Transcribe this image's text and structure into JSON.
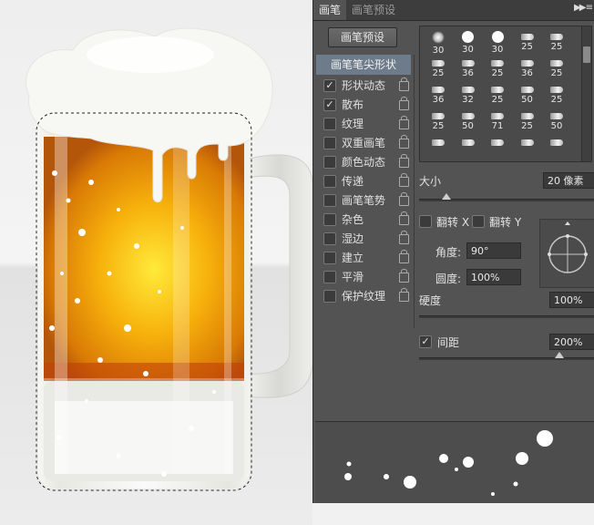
{
  "panel": {
    "tabs": [
      "画笔",
      "画笔预设"
    ],
    "preset_button": "画笔预设",
    "options": [
      {
        "label": "画笔笔尖形状",
        "checked": null
      },
      {
        "label": "形状动态",
        "checked": true
      },
      {
        "label": "散布",
        "checked": true
      },
      {
        "label": "纹理",
        "checked": false
      },
      {
        "label": "双重画笔",
        "checked": false
      },
      {
        "label": "颜色动态",
        "checked": false
      },
      {
        "label": "传递",
        "checked": false
      },
      {
        "label": "画笔笔势",
        "checked": false
      },
      {
        "label": "杂色",
        "checked": false
      },
      {
        "label": "湿边",
        "checked": false
      },
      {
        "label": "建立",
        "checked": false
      },
      {
        "label": "平滑",
        "checked": false
      },
      {
        "label": "保护纹理",
        "checked": false
      }
    ],
    "brush_tips": [
      {
        "size": "30",
        "icon": "soft-round"
      },
      {
        "size": "30",
        "icon": "hard-round"
      },
      {
        "size": "30",
        "icon": "hard-round"
      },
      {
        "size": "25",
        "icon": "stroke"
      },
      {
        "size": "25",
        "icon": "stroke"
      },
      {
        "size": "25",
        "icon": "stroke"
      },
      {
        "size": "36",
        "icon": "stroke"
      },
      {
        "size": "25",
        "icon": "stroke"
      },
      {
        "size": "36",
        "icon": "stroke"
      },
      {
        "size": "25",
        "icon": "stroke"
      },
      {
        "size": "36",
        "icon": "stroke"
      },
      {
        "size": "32",
        "icon": "stroke"
      },
      {
        "size": "25",
        "icon": "stroke"
      },
      {
        "size": "50",
        "icon": "stroke"
      },
      {
        "size": "25",
        "icon": "stroke"
      },
      {
        "size": "25",
        "icon": "stroke"
      },
      {
        "size": "50",
        "icon": "stroke"
      },
      {
        "size": "71",
        "icon": "stroke"
      },
      {
        "size": "25",
        "icon": "stroke"
      },
      {
        "size": "50",
        "icon": "stroke"
      },
      {
        "size": "",
        "icon": "stroke"
      },
      {
        "size": "",
        "icon": "stroke"
      },
      {
        "size": "",
        "icon": "stroke"
      },
      {
        "size": "",
        "icon": "stroke"
      },
      {
        "size": "",
        "icon": "stroke"
      }
    ],
    "size": {
      "label": "大小",
      "value": "20 像素",
      "level": 0.07
    },
    "flip_x": {
      "label": "翻转 X",
      "checked": false
    },
    "flip_y": {
      "label": "翻转 Y",
      "checked": false
    },
    "angle": {
      "label": "角度:",
      "value": "90°"
    },
    "roundness": {
      "label": "圆度:",
      "value": "100%"
    },
    "hardness": {
      "label": "硬度",
      "value": "100%",
      "level": 1.0
    },
    "spacing": {
      "label": "间距",
      "checked": true,
      "value": "200%",
      "level": 0.75
    }
  }
}
